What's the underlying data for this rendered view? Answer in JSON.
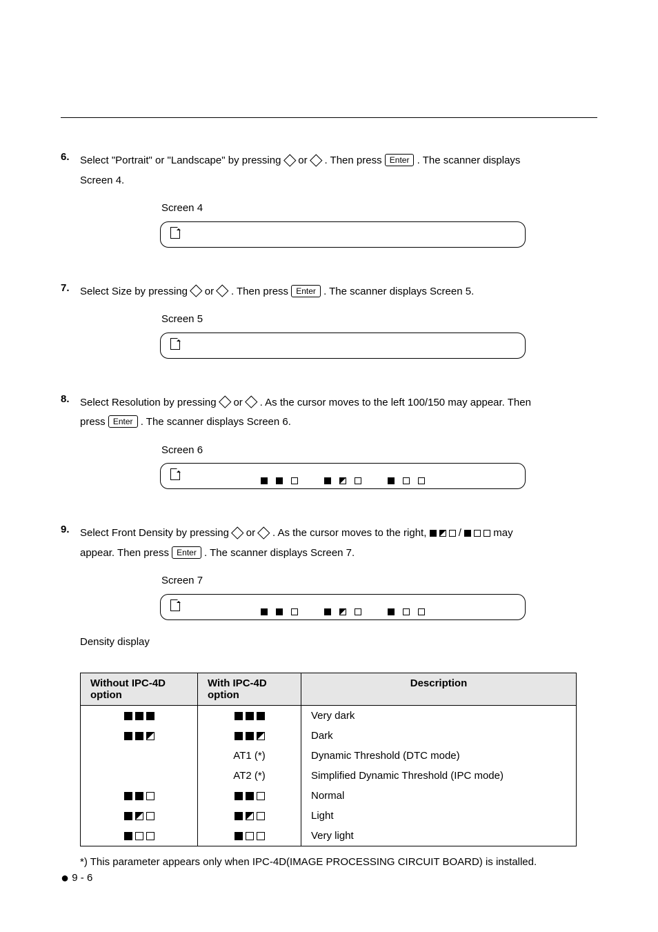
{
  "steps": {
    "s6": {
      "num": "6.",
      "text_a": "Select \"Portrait\" or \"Landscape\" by pressing ",
      "text_b": " or ",
      "text_c": " . Then press ",
      "text_d": " . The scanner displays",
      "text_e": "Screen 4.",
      "screen_label": "Screen 4"
    },
    "s7": {
      "num": "7.",
      "text_a": "Select Size by pressing ",
      "text_b": " or ",
      "text_c": ". Then press ",
      "text_d": " . The scanner displays Screen 5.",
      "screen_label": "Screen 5"
    },
    "s8": {
      "num": "8.",
      "text_a": "Select Resolution by pressing ",
      "text_b": " or ",
      "text_c": " . As the cursor moves to the left 100/150 may appear. Then",
      "text_d": "press ",
      "text_e": " . The scanner displays Screen 6.",
      "screen_label": "Screen 6"
    },
    "s9": {
      "num": "9.",
      "text_a": "Select Front Density by pressing ",
      "text_b": " or ",
      "text_c": " . As the cursor moves to the right, ",
      "text_d": " / ",
      "text_e": " may",
      "text_f": "appear. Then press ",
      "text_g": " . The scanner displays Screen 7.",
      "screen_label": "Screen 7"
    }
  },
  "keys": {
    "enter": "Enter"
  },
  "density_heading": "Density display",
  "table": {
    "headers": {
      "col1": "Without IPC-4D option",
      "col2": "With IPC-4D option",
      "col3": "Description"
    },
    "rows": {
      "r0": {
        "at1": "AT1 (*)",
        "at2": "AT2 (*)",
        "d0": "Very dark",
        "d1": "Dark",
        "d2": "Dynamic Threshold (DTC mode)",
        "d3": "Simplified Dynamic Threshold (IPC mode)",
        "d4": "Normal",
        "d5": "Light",
        "d6": "Very light"
      }
    }
  },
  "footnote": "*) This parameter appears only when IPC-4D(IMAGE PROCESSING CIRCUIT BOARD) is installed.",
  "footer": "9 - 6"
}
